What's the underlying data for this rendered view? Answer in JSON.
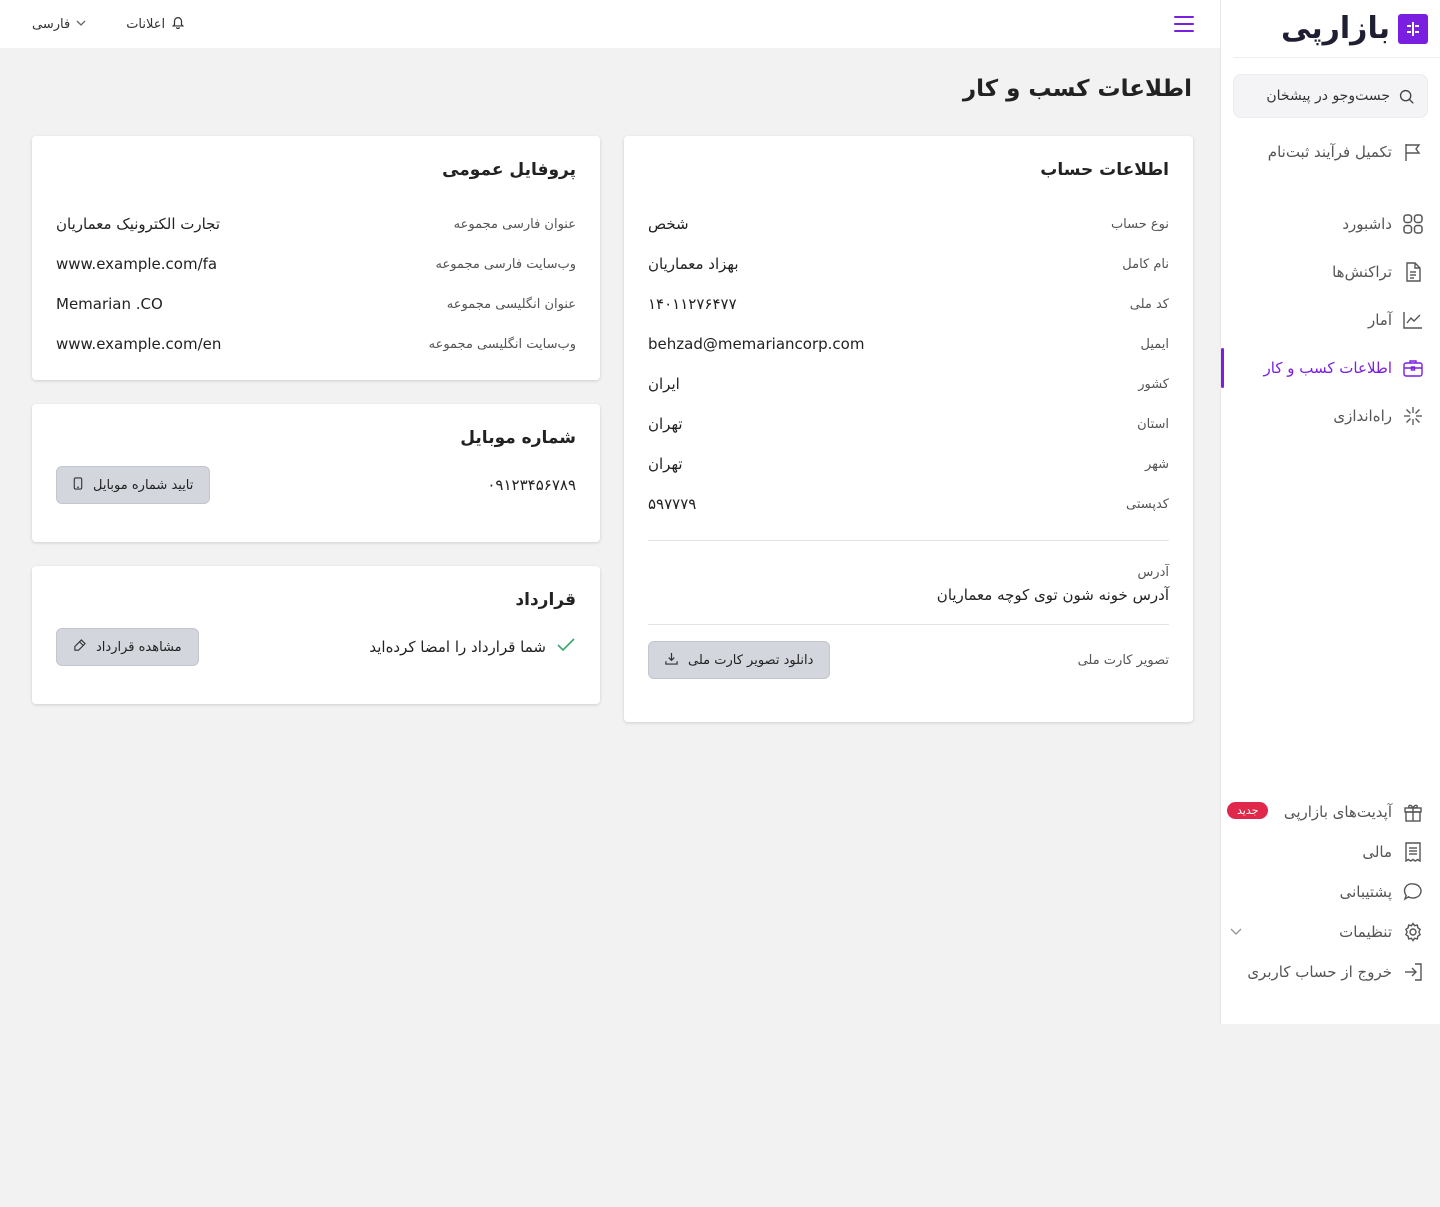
{
  "brand": {
    "name": "بازارپی",
    "color": "#7a1fe0"
  },
  "search": {
    "placeholder": "جست‌وجو در پیشخان"
  },
  "sidebar": {
    "top_items": [
      {
        "label": "تکمیل فرآیند ثبت‌نام",
        "icon": "flag-icon"
      }
    ],
    "main_items": [
      {
        "label": "داشبورد",
        "icon": "grid-icon"
      },
      {
        "label": "تراکنش‌ها",
        "icon": "document-icon"
      },
      {
        "label": "آمار",
        "icon": "chart-icon"
      },
      {
        "label": "اطلاعات کسب و کار",
        "icon": "briefcase-icon",
        "active": true
      },
      {
        "label": "راه‌اندازی",
        "icon": "setup-icon"
      }
    ],
    "bottom_items": [
      {
        "label": "آپدیت‌های بازارپی",
        "icon": "gift-icon",
        "badge": "جدید"
      },
      {
        "label": "مالی",
        "icon": "receipt-icon"
      },
      {
        "label": "پشتیبانی",
        "icon": "chat-icon"
      },
      {
        "label": "تنظیمات",
        "icon": "gear-icon"
      },
      {
        "label": "خروج از حساب کاربری",
        "icon": "logout-icon"
      }
    ]
  },
  "topbar": {
    "notifications": "اعلانات",
    "language": "فارسی"
  },
  "page": {
    "title": "اطلاعات کسب و کار"
  },
  "account": {
    "title": "اطلاعات حساب",
    "rows": [
      {
        "label": "نوع حساب",
        "value": "شخص"
      },
      {
        "label": "نام کامل",
        "value": "بهزاد معماریان"
      },
      {
        "label": "کد ملی",
        "value": "۱۴۰۱۱۲۷۶۴۷۷"
      },
      {
        "label": "ایمیل",
        "value": "behzad@memariancorp.com"
      },
      {
        "label": "کشور",
        "value": "ایران"
      },
      {
        "label": "استان",
        "value": "تهران"
      },
      {
        "label": "شهر",
        "value": "تهران"
      },
      {
        "label": "کدپستی",
        "value": "۵۹۷۷۷۹"
      }
    ],
    "address_label": "آدرس",
    "address_value": "آدرس خونه شون توی کوچه معماریان",
    "id_card_label": "تصویر کارت ملی",
    "download_button": "دانلود تصویر کارت ملی"
  },
  "profile": {
    "title": "پروفایل عمومی",
    "rows": [
      {
        "label": "عنوان فارسی مجموعه",
        "value": "تجارت الکترونیک معماریان"
      },
      {
        "label": "وب‌سایت فارسی مجموعه",
        "value": "www.example.com/fa"
      },
      {
        "label": "عنوان انگلیسی مجموعه",
        "value": "Memarian .CO"
      },
      {
        "label": "وب‌سایت انگلیسی مجموعه",
        "value": "www.example.com/en"
      }
    ]
  },
  "mobile": {
    "title": "شماره موبایل",
    "number": "۰۹۱۲۳۴۵۶۷۸۹",
    "verify_button": "تایید شماره موبایل"
  },
  "contract": {
    "title": "قرارداد",
    "status": "شما قرارداد را امضا کرده‌اید",
    "view_button": "مشاهده قرارداد"
  }
}
